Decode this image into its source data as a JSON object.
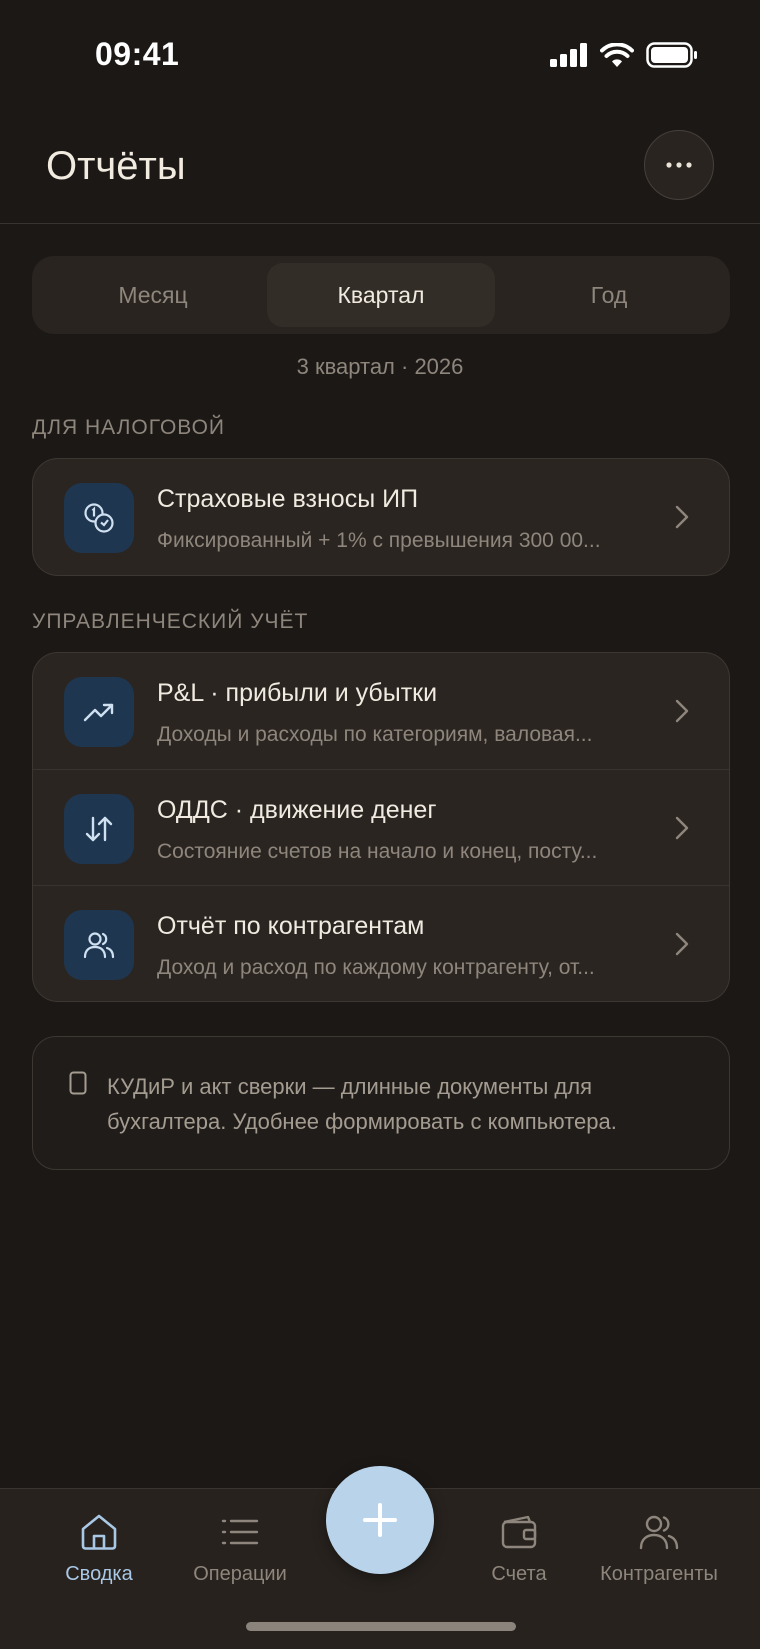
{
  "status": {
    "time": "09:41"
  },
  "header": {
    "title": "Отчёты"
  },
  "segments": [
    {
      "label": "Месяц",
      "active": false
    },
    {
      "label": "Квартал",
      "active": true
    },
    {
      "label": "Год",
      "active": false
    }
  ],
  "period": "3 квартал · 2026",
  "tax_section": {
    "label": "ДЛЯ НАЛОГОВОЙ",
    "items": [
      {
        "title": "Страховые взносы ИП",
        "subtitle": "Фиксированный + 1% с превышения 300 00...",
        "icon": "coins-icon"
      }
    ]
  },
  "mgmt_section": {
    "label": "УПРАВЛЕНЧЕСКИЙ УЧЁТ",
    "items": [
      {
        "title": "P&L · прибыли и убытки",
        "subtitle": "Доходы и расходы по категориям, валовая...",
        "icon": "trend-up-icon"
      },
      {
        "title": "ОДДС · движение денег",
        "subtitle": "Состояние счетов на начало и конец, посту...",
        "icon": "arrows-updown-icon"
      },
      {
        "title": "Отчёт по контрагентам",
        "subtitle": "Доход и расход по каждому контрагенту, от...",
        "icon": "users-icon"
      }
    ]
  },
  "notice": {
    "icon": "phone-icon",
    "line1": "КУДиР и акт сверки — длинные документы для",
    "line2": "бухгалтера. Удобнее формировать с компьютера."
  },
  "tabs": [
    {
      "label": "Сводка",
      "icon": "home-icon",
      "active": true
    },
    {
      "label": "Операции",
      "icon": "list-icon",
      "active": false
    },
    {
      "label": "Счета",
      "icon": "wallet-icon",
      "active": false
    },
    {
      "label": "Контрагенты",
      "icon": "users-icon",
      "active": false
    }
  ],
  "colors": {
    "accent": "#b9d4ea",
    "active_tab": "#a9c8e6",
    "icon_tile": "#1f3650",
    "background": "#1c1816"
  }
}
